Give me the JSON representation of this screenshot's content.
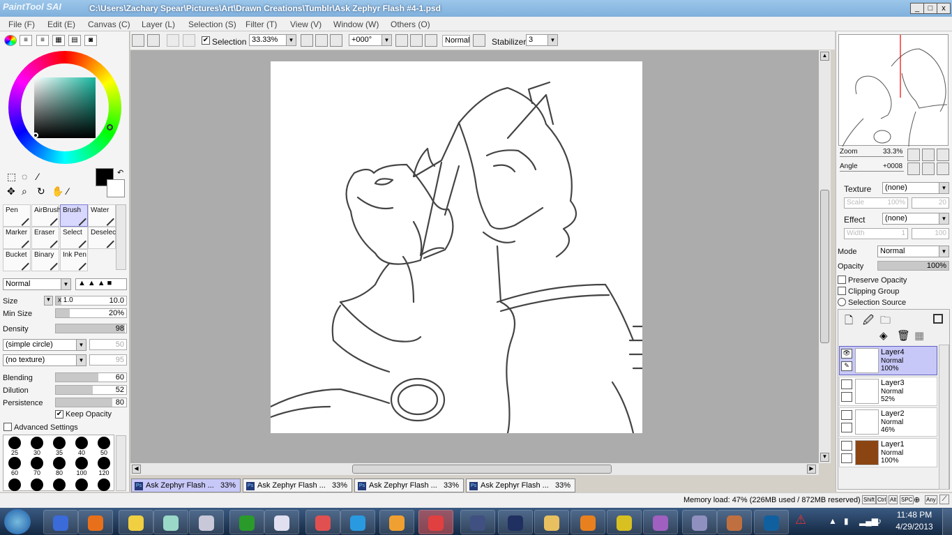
{
  "window": {
    "app_logo": "PaintTool SAI",
    "title": "C:\\Users\\Zachary Spear\\Pictures\\Art\\Drawn Creations\\Tumblr\\Ask Zephyr Flash #4-1.psd",
    "min": "_",
    "max": "□",
    "close": "x"
  },
  "menu": [
    "File (F)",
    "Edit (E)",
    "Canvas (C)",
    "Layer (L)",
    "Selection (S)",
    "Filter (T)",
    "View (V)",
    "Window (W)",
    "Others (O)"
  ],
  "toolbar": {
    "selection_label": "Selection",
    "zoom": "33.33%",
    "angle": "+000°",
    "blend": "Normal",
    "stabilizer_label": "Stabilizer",
    "stabilizer": "3"
  },
  "tools": [
    {
      "label": "Pen"
    },
    {
      "label": "AirBrush"
    },
    {
      "label": "Brush"
    },
    {
      "label": "Water"
    },
    {
      "label": "Marker"
    },
    {
      "label": "Eraser"
    },
    {
      "label": "Select"
    },
    {
      "label": "Deselect"
    },
    {
      "label": "Bucket"
    },
    {
      "label": "Binary"
    },
    {
      "label": "Ink Pen"
    }
  ],
  "brush": {
    "mode": "Normal",
    "size_label": "Size",
    "size_mult": "x 1.0",
    "size_val": "10.0",
    "minsize_label": "Min Size",
    "minsize": "20%",
    "density_label": "Density",
    "density": "98",
    "shape": "(simple circle)",
    "shape_val": "50",
    "texture": "(no texture)",
    "texture_val": "95",
    "blending_label": "Blending",
    "blending": "60",
    "dilution_label": "Dilution",
    "dilution": "52",
    "persistence_label": "Persistence",
    "persistence": "80",
    "keep_opacity": "Keep Opacity",
    "advanced": "Advanced Settings"
  },
  "brush_sizes": [
    "25",
    "30",
    "35",
    "40",
    "50",
    "60",
    "70",
    "80",
    "100",
    "120"
  ],
  "navigator": {
    "zoom_label": "Zoom",
    "zoom": "33.3%",
    "angle_label": "Angle",
    "angle": "+0008"
  },
  "layer_panel": {
    "texture_label": "Texture",
    "texture": "(none)",
    "scale_label": "Scale",
    "scale": "100%",
    "scale2": "20",
    "effect_label": "Effect",
    "effect": "(none)",
    "width_label": "Width",
    "width": "1",
    "width2": "100",
    "mode_label": "Mode",
    "mode": "Normal",
    "opacity_label": "Opacity",
    "opacity": "100%",
    "preserve": "Preserve Opacity",
    "clipping": "Clipping Group",
    "selsource": "Selection Source"
  },
  "layers": [
    {
      "name": "Layer4",
      "mode": "Normal",
      "opacity": "100%"
    },
    {
      "name": "Layer3",
      "mode": "Normal",
      "opacity": "52%"
    },
    {
      "name": "Layer2",
      "mode": "Normal",
      "opacity": "46%"
    },
    {
      "name": "Layer1",
      "mode": "Normal",
      "opacity": "100%"
    }
  ],
  "doc_tabs": [
    {
      "name": "Ask Zephyr Flash ...",
      "pct": "33%"
    },
    {
      "name": "Ask Zephyr Flash ...",
      "pct": "33%"
    },
    {
      "name": "Ask Zephyr Flash ...",
      "pct": "33%"
    },
    {
      "name": "Ask Zephyr Flash ...",
      "pct": "33%"
    }
  ],
  "status": {
    "memory": "Memory load: 47% (226MB used / 872MB reserved)",
    "keys": [
      "Shift",
      "Ctrl",
      "Alt",
      "SPC",
      "Any"
    ]
  },
  "clock": {
    "time": "11:48 PM",
    "date": "4/29/2013"
  },
  "colors": {
    "accent": "#c8c8f8",
    "canvas_bg": "#acacac",
    "layer1": "#8b4513"
  }
}
